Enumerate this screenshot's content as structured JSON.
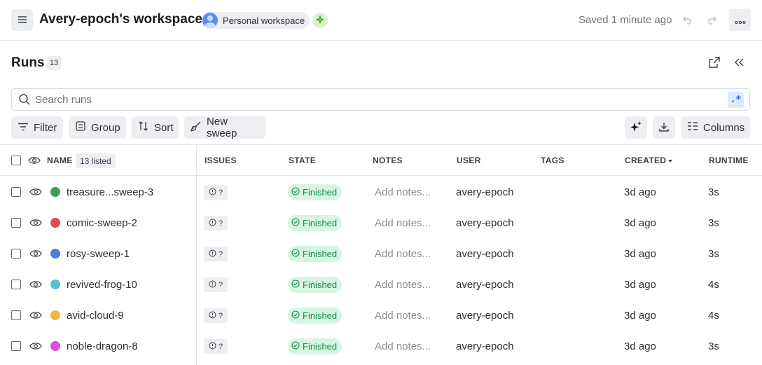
{
  "topbar": {
    "workspace_title": "Avery-epoch's workspace",
    "workspace_type": "Personal workspace",
    "saved_status": "Saved 1 minute ago"
  },
  "runs": {
    "title": "Runs",
    "count": "13"
  },
  "search": {
    "placeholder": "Search runs",
    "value": "",
    "regex_label": ".*"
  },
  "toolbar": {
    "filter_label": "Filter",
    "group_label": "Group",
    "sort_label": "Sort",
    "new_sweep_label": "New sweep",
    "columns_label": "Columns"
  },
  "table": {
    "headers": {
      "name": "NAME",
      "listed": "13 listed",
      "issues": "ISSUES",
      "state": "STATE",
      "notes": "NOTES",
      "user": "USER",
      "tags": "TAGS",
      "created": "CREATED",
      "runtime": "RUNTIME"
    },
    "rows": [
      {
        "name": "treasure...sweep-3",
        "color": "#3f9b5a",
        "issues": "?",
        "state": "Finished",
        "notes": "Add notes...",
        "user": "avery-epoch",
        "tags": "",
        "created": "3d ago",
        "runtime": "3s"
      },
      {
        "name": "comic-sweep-2",
        "color": "#e8474b",
        "issues": "?",
        "state": "Finished",
        "notes": "Add notes...",
        "user": "avery-epoch",
        "tags": "",
        "created": "3d ago",
        "runtime": "3s"
      },
      {
        "name": "rosy-sweep-1",
        "color": "#4a7fe0",
        "issues": "?",
        "state": "Finished",
        "notes": "Add notes...",
        "user": "avery-epoch",
        "tags": "",
        "created": "3d ago",
        "runtime": "3s"
      },
      {
        "name": "revived-frog-10",
        "color": "#52c1d6",
        "issues": "?",
        "state": "Finished",
        "notes": "Add notes...",
        "user": "avery-epoch",
        "tags": "",
        "created": "3d ago",
        "runtime": "4s"
      },
      {
        "name": "avid-cloud-9",
        "color": "#f6b33d",
        "issues": "?",
        "state": "Finished",
        "notes": "Add notes...",
        "user": "avery-epoch",
        "tags": "",
        "created": "3d ago",
        "runtime": "4s"
      },
      {
        "name": "noble-dragon-8",
        "color": "#dd4fd6",
        "issues": "?",
        "state": "Finished",
        "notes": "Add notes...",
        "user": "avery-epoch",
        "tags": "",
        "created": "3d ago",
        "runtime": "3s"
      }
    ]
  },
  "icons": {
    "menu": "hamburger-icon",
    "sparkle": "sparkle-icon",
    "undo": "undo-icon",
    "redo": "redo-icon",
    "more": "more-horizontal-icon",
    "export": "export-icon",
    "collapse": "collapse-left-icon",
    "search": "search-icon",
    "filter": "filter-icon",
    "group": "group-icon",
    "sort": "sort-icon",
    "sweep": "broom-icon",
    "ai": "ai-sparkle-icon",
    "download": "download-icon",
    "columns": "columns-icon",
    "eye": "eye-icon",
    "issue": "info-circle-icon",
    "state": "check-circle-icon"
  },
  "colors": {
    "finished_bg": "#d7f5e3",
    "finished_text": "#178a4c",
    "regex_bg": "#dbeafe",
    "regex_text": "#2563c9",
    "button_bg": "#eceef1"
  }
}
